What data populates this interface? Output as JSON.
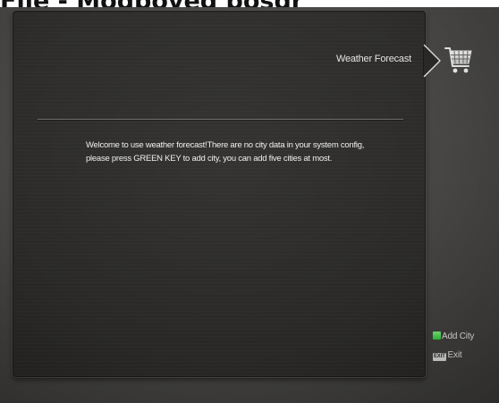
{
  "caption": "File - Modpoved posdr",
  "panel": {
    "title": "Weather Forecast",
    "message": "Welcome to use weather forecast!There are no city data in your system config, please press GREEN KEY to add city, you can add five cities at most."
  },
  "side_icon": "shopping-cart-icon",
  "hints": {
    "add_city": {
      "key_label": "",
      "label": "Add City",
      "key_color": "#3fd84a"
    },
    "exit": {
      "key_label": "EXIT",
      "label": "Exit"
    }
  },
  "colors": {
    "screen_background": "#464543",
    "panel_background": "#2d2c2a",
    "text": "#efefed",
    "divider": "#6a6966"
  }
}
